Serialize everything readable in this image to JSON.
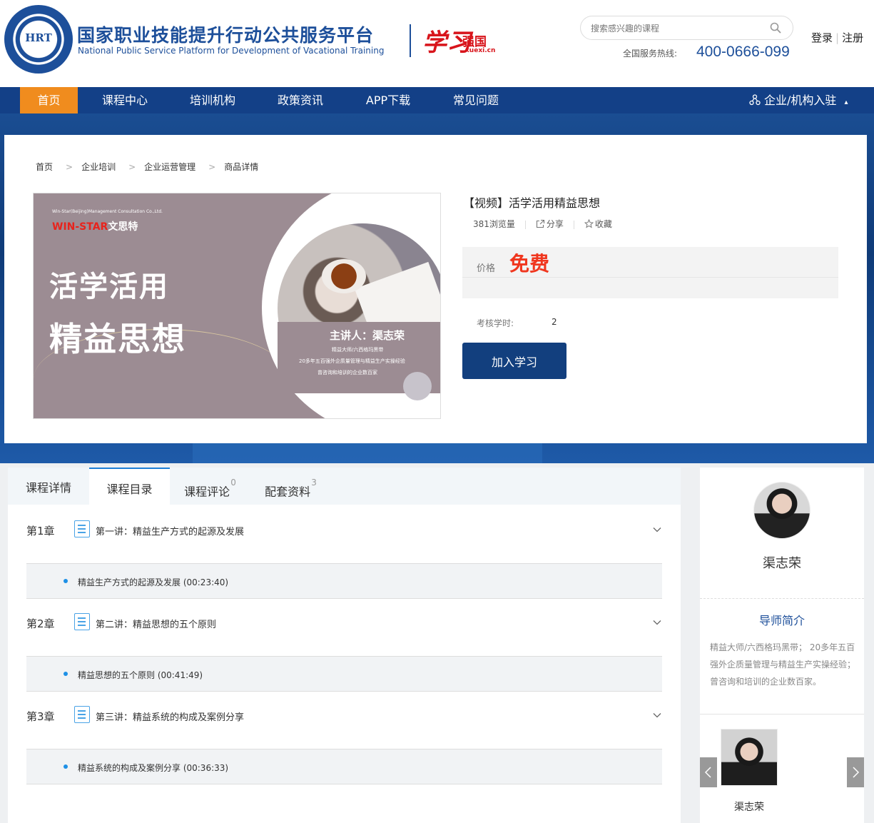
{
  "header": {
    "seal_text": "HRT",
    "brand_cn": "国家职业技能提升行动公共服务平台",
    "brand_en": "National Public Service Platform for Development of Vacational Training",
    "xuexi_script": "学习",
    "xuexi_qiang": "强国",
    "xuexi_url": "xuexi.cn",
    "search_placeholder": "搜索感兴趣的课程",
    "hotline_label": "全国服务热线:",
    "hotline_number": "400-0666-099",
    "login": "登录",
    "separator": "|",
    "register": "注册"
  },
  "nav": {
    "items": [
      "首页",
      "课程中心",
      "培训机构",
      "政策资讯",
      "APP下载",
      "常见问题"
    ],
    "active_index": 0,
    "right_label": "企业/机构入驻",
    "right_caret": "▴"
  },
  "breadcrumb": {
    "items": [
      "首页",
      "企业培训",
      "企业运营管理",
      "商品详情"
    ],
    "separator": ">"
  },
  "cover": {
    "company": "Win-Star(Beijing)Management Consultation Co.,Ltd.",
    "logo_en": "WIN-STAR",
    "logo_cn": "文思特",
    "title_line1": "活学活用",
    "title_line2": "精益思想",
    "speaker": "主讲人：渠志荣",
    "desc1": "精益大师/六西格玛黑带",
    "desc2": "20多年五百强外企质量管理与精益生产实操经验",
    "desc3": "曾咨询和培训的企业数百家"
  },
  "product": {
    "title": "【视频】活学活用精益思想",
    "views": "381浏览量",
    "share": "分享",
    "favorite": "收藏",
    "price_label": "价格",
    "price_value": "免费",
    "hours_label": "考核学时:",
    "hours_value": "2",
    "join_button": "加入学习"
  },
  "tabs": [
    {
      "label": "课程详情",
      "count": ""
    },
    {
      "label": "课程目录",
      "count": ""
    },
    {
      "label": "课程评论",
      "count": "0"
    },
    {
      "label": "配套资料",
      "count": "3"
    }
  ],
  "active_tab": 1,
  "chapters": [
    {
      "number": "第1章",
      "title": "第一讲：精益生产方式的起源及发展",
      "lesson": "精益生产方式的起源及发展 (00:23:40)"
    },
    {
      "number": "第2章",
      "title": "第二讲：精益思想的五个原则",
      "lesson": "精益思想的五个原则 (00:41:49)"
    },
    {
      "number": "第3章",
      "title": "第三讲：精益系统的构成及案例分享",
      "lesson": "精益系统的构成及案例分享 (00:36:33)"
    }
  ],
  "teacher": {
    "name": "渠志荣",
    "intro_heading": "导师简介",
    "intro": "精益大师/六西格玛黑带；  20多年五百强外企质量管理与精益生产实操经验；  曾咨询和培训的企业数百家。",
    "carousel_name": "渠志荣"
  },
  "colors": {
    "brand_blue": "#1d4f9a",
    "nav_blue": "#134087",
    "active_orange": "#f08c1e",
    "price_red": "#f0361e",
    "tab_accent": "#1e7fd6"
  }
}
